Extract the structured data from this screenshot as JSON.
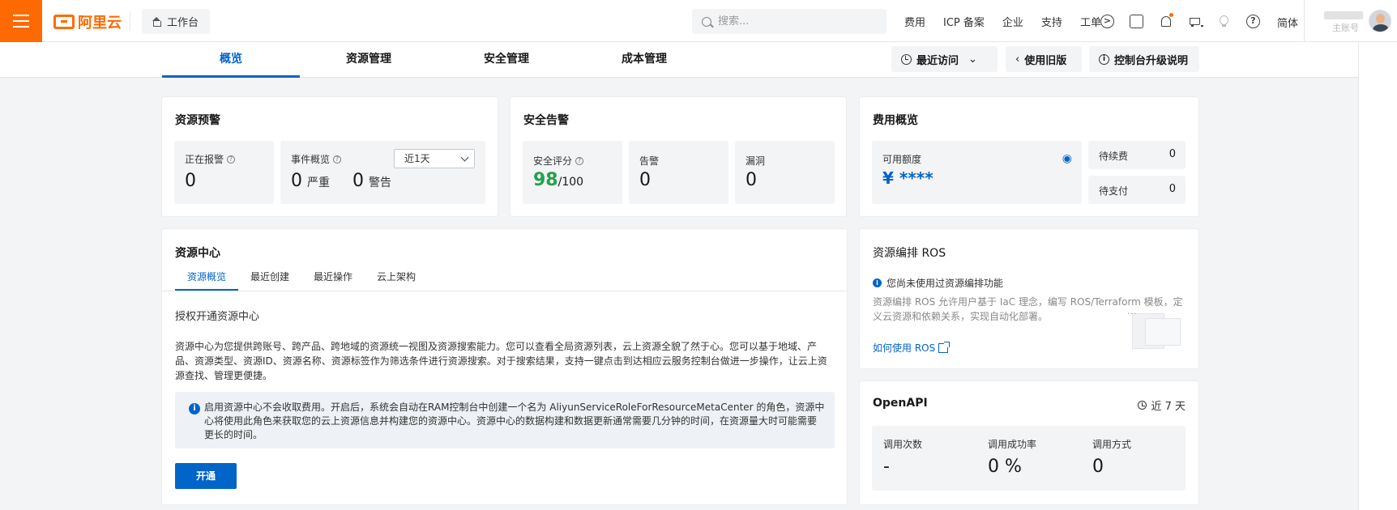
{
  "topbar": {
    "logo_text": "阿里云",
    "workbench_label": "工作台",
    "search_placeholder": "搜索...",
    "links": [
      "费用",
      "ICP 备案",
      "企业",
      "支持",
      "工单"
    ],
    "language": "简体",
    "account_sub": "主账号",
    "accent_color": "#ff6a00"
  },
  "tabs": {
    "items": [
      "概览",
      "资源管理",
      "安全管理",
      "成本管理"
    ],
    "active": "概览",
    "recent_visit": "最近访问",
    "old_version": "使用旧版",
    "upgrade_note": "控制台升级说明"
  },
  "resource_alert": {
    "title": "资源预警",
    "alarming_label": "正在报警",
    "alarming_value": "0",
    "events_label": "事件概览",
    "range_select": "近1天",
    "serious_value": "0",
    "serious_label": "严重",
    "warning_value": "0",
    "warning_label": "警告"
  },
  "security_alert": {
    "title": "安全告警",
    "score_label": "安全评分",
    "score_value": "98",
    "score_max": "/100",
    "alarm_label": "告警",
    "alarm_value": "0",
    "vuln_label": "漏洞",
    "vuln_value": "0",
    "score_color": "#1fa34a"
  },
  "cost_overview": {
    "title": "费用概览",
    "credit_label": "可用额度",
    "credit_value": "¥ ****",
    "renew_label": "待续费",
    "renew_value": "0",
    "pay_label": "待支付",
    "pay_value": "0"
  },
  "resource_center": {
    "title": "资源中心",
    "sub_tabs": [
      "资源概览",
      "最近创建",
      "最近操作",
      "云上架构"
    ],
    "active_tab": "资源概览",
    "heading": "授权开通资源中心",
    "description": "资源中心为您提供跨账号、跨产品、跨地域的资源统一视图及资源搜索能力。您可以查看全局资源列表，云上资源全貌了然于心。您可以基于地域、产品、资源类型、资源ID、资源名称、资源标签作为筛选条件进行资源搜索。对于搜索结果，支持一键点击到达相应云服务控制台做进一步操作，让云上资源查找、管理更便捷。",
    "notice": "启用资源中心不会收取费用。开启后，系统会自动在RAM控制台中创建一个名为 AliyunServiceRoleForResourceMetaCenter 的角色，资源中心将使用此角色来获取您的云上资源信息并构建您的资源中心。资源中心的数据构建和数据更新通常需要几分钟的时间，在资源量大时可能需要更长的时间。",
    "enable_button": "开通"
  },
  "ros": {
    "title": "资源编排 ROS",
    "status": "您尚未使用过资源编排功能",
    "description": "资源编排 ROS 允许用户基于 IaC 理念，编写 ROS/Terraform 模板，定义云资源和依赖关系，实现自动化部署。",
    "link": "如何使用 ROS"
  },
  "openapi": {
    "title": "OpenAPI",
    "range": "近 7 天",
    "calls_label": "调用次数",
    "calls_value": "-",
    "success_label": "调用成功率",
    "success_value": "0 %",
    "method_label": "调用方式",
    "method_value": "0"
  }
}
